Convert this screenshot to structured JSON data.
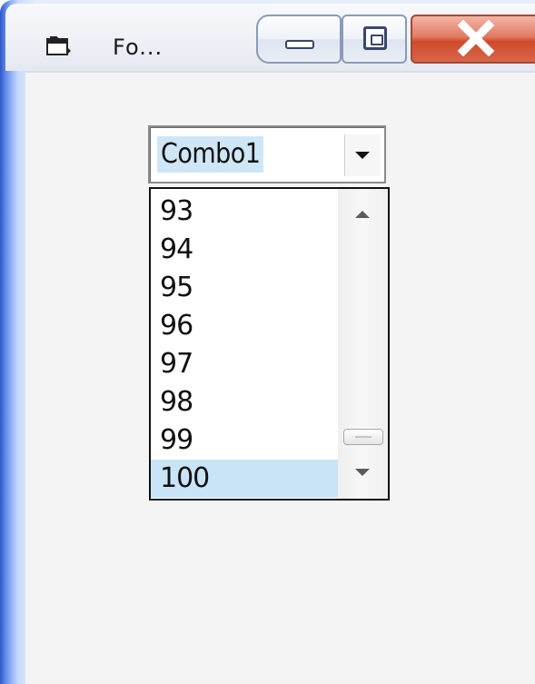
{
  "window": {
    "title": "Fo...",
    "icon": "form-window-icon",
    "controls": {
      "minimize_icon": "minimize-icon",
      "maximize_icon": "maximize-icon",
      "close_icon": "close-icon"
    }
  },
  "combo": {
    "value": "Combo1",
    "dropdown_icon": "chevron-down-icon"
  },
  "dropdown": {
    "items": [
      "93",
      "94",
      "95",
      "96",
      "97",
      "98",
      "99",
      "100"
    ],
    "selected": "100"
  },
  "colors": {
    "selection": "#c9e4f6",
    "close_button": "#d9654a",
    "frame": "#2f57c8"
  }
}
